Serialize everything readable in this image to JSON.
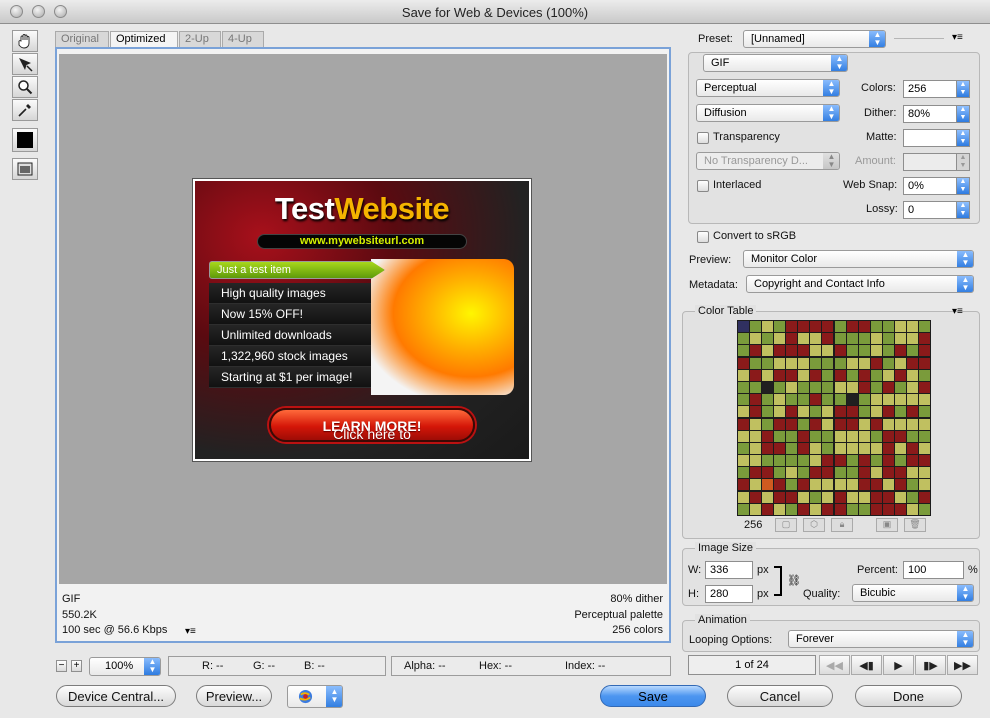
{
  "window": {
    "title": "Save for Web & Devices (100%)"
  },
  "tabs": [
    "Original",
    "Optimized",
    "2-Up",
    "4-Up"
  ],
  "ad": {
    "title_a": "Test",
    "title_b": "Website",
    "url": "www.mywebsiteurl.com",
    "items": [
      "Just a test item",
      "High quality images",
      "Now 15% OFF!",
      "Unlimited downloads",
      "1,322,960 stock images",
      "Starting at $1 per image!"
    ],
    "cta_a": "Click here to ",
    "cta_b": "LEARN MORE!"
  },
  "info": {
    "format": "GIF",
    "size": "550.2K",
    "time": "100 sec @ 56.6 Kbps",
    "dither": "80% dither",
    "palette": "Perceptual palette",
    "colors": "256 colors"
  },
  "status": {
    "zoom": "100%",
    "r": "R: --",
    "g": "G: --",
    "b": "B: --",
    "alpha": "Alpha: --",
    "hex": "Hex: --",
    "index": "Index: --"
  },
  "buttons": {
    "device_central": "Device Central...",
    "preview": "Preview...",
    "save": "Save",
    "cancel": "Cancel",
    "done": "Done"
  },
  "settings": {
    "preset_label": "Preset:",
    "preset_value": "[Unnamed]",
    "format": "GIF",
    "reduction": "Perceptual",
    "dither_algo": "Diffusion",
    "colors_label": "Colors:",
    "colors_value": "256",
    "dither_label": "Dither:",
    "dither_value": "80%",
    "transparency_label": "Transparency",
    "matte_label": "Matte:",
    "matte_value": "",
    "trans_dither": "No Transparency D...",
    "amount_label": "Amount:",
    "interlaced_label": "Interlaced",
    "websnap_label": "Web Snap:",
    "websnap_value": "0%",
    "lossy_label": "Lossy:",
    "lossy_value": "0",
    "convert_label": "Convert to sRGB",
    "preview_label": "Preview:",
    "preview_value": "Monitor Color",
    "metadata_label": "Metadata:",
    "metadata_value": "Copyright and Contact Info"
  },
  "color_table": {
    "legend": "Color Table",
    "count": "256"
  },
  "image_size": {
    "legend": "Image Size",
    "w_label": "W:",
    "w_value": "336",
    "h_label": "H:",
    "h_value": "280",
    "unit": "px",
    "percent_label": "Percent:",
    "percent_value": "100",
    "percent_unit": "%",
    "quality_label": "Quality:",
    "quality_value": "Bicubic"
  },
  "animation": {
    "legend": "Animation",
    "looping_label": "Looping Options:",
    "looping_value": "Forever",
    "frame": "1 of 24"
  },
  "colors": {
    "accent": "#3c89ea",
    "canvas_gray": "#a6a6a6",
    "selection_border": "#7aa2d8"
  }
}
